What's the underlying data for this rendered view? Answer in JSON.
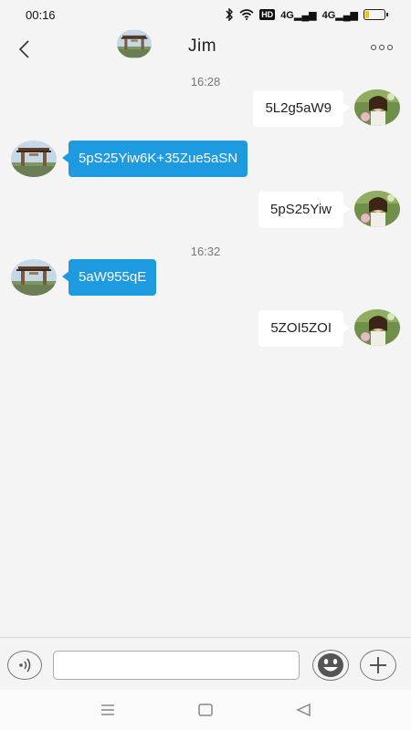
{
  "status_bar": {
    "time": "00:16",
    "hd_label": "HD",
    "signal_1": "4G",
    "signal_2": "4G",
    "battery_level": 0.2,
    "icons": [
      "bluetooth-icon",
      "wifi-icon",
      "hd-icon",
      "signal-icon",
      "signal-icon",
      "battery-icon"
    ]
  },
  "header": {
    "title": "Jim",
    "back_icon": "chevron-left-icon",
    "more_icon": "more-icon"
  },
  "messages": [
    {
      "type": "timestamp",
      "text": "16:28"
    },
    {
      "type": "outgoing",
      "text": "5L2g5aW9"
    },
    {
      "type": "incoming",
      "text": "5pS25Yiw6K+35Zue5aSN"
    },
    {
      "type": "outgoing",
      "text": "5pS25Yiw"
    },
    {
      "type": "timestamp",
      "text": "16:32"
    },
    {
      "type": "incoming",
      "text": "5aW955qE"
    },
    {
      "type": "outgoing",
      "text": "5ZOI5ZOI"
    }
  ],
  "input_bar": {
    "placeholder": "",
    "value": "",
    "voice_icon": "voice-icon",
    "emoji_icon": "emoji-icon",
    "plus_icon": "plus-icon"
  },
  "nav_bar": {
    "icons": [
      "menu-icon",
      "home-icon",
      "back-triangle-icon"
    ]
  },
  "colors": {
    "incoming_bubble": "#1e9ae0",
    "outgoing_bubble": "#ffffff",
    "background": "#f4f4f4"
  }
}
